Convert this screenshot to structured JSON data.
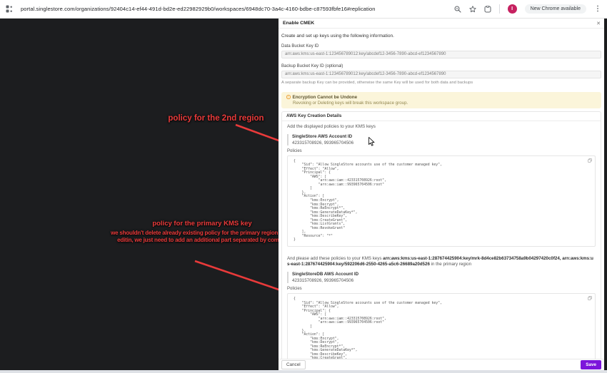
{
  "browser": {
    "url": "portal.singlestore.com/organizations/92404c14-ef44-491d-bd2e-ed22982929b0/workspaces/6948dc70-3a4c-4160-bdbe-c87593fbfe16#replication",
    "update_pill": "New Chrome available",
    "profile_initial": "I",
    "kebab_glyph": "⋮"
  },
  "overlay": {
    "note_second_region": "policy for the 2nd region",
    "note_primary_title": "policy for the primary KMS key",
    "note_primary_body": "we shouldn't delete already existing policy for the primary region when editin, we just need to add an additional part separated by comma"
  },
  "modal": {
    "title": "Enable CMEK",
    "close_glyph": "✕",
    "intro": "Create and set up keys using the following information.",
    "fields": {
      "data_key_label": "Data Bucket Key ID",
      "data_key_value": "arn:aws:kms:us-east-1:123456789012:key/abcdef12-3456-7890-abcd-ef1234567890",
      "backup_key_label": "Backup Bucket Key ID (optional)",
      "backup_key_value": "arn:aws:kms:us-east-1:123456789012:key/abcdef12-3456-7890-abcd-ef1234567890",
      "backup_key_hint": "A separate backup Key can be provided, otherwise the same Key will be used for both data and backups"
    },
    "warning": {
      "icon_glyph": "!",
      "title": "Encryption Cannot be Undone",
      "body": "Revoking or Deleting keys will break this workspace group."
    },
    "aws_section": {
      "title": "AWS Key Creation Details",
      "instruction": "Add the displayed policies to your KMS keys",
      "account_block_1": {
        "label": "SingleStore AWS Account ID",
        "value": "423315708926, 993965704506"
      },
      "policies_label_1": "Policies",
      "policy_code_1": "{\n    \"Sid\": \"Allow SingleStore accounts use of the customer managed key\",\n    \"Effect\": \"Allow\",\n    \"Principal\": {\n        \"AWS\": [\n            \"arn:aws:iam::423315708926:root\",\n            \"arn:aws:iam::993965704506:root\"\n        ]\n    },\n    \"Action\": [\n        \"kms:Encrypt\",\n        \"kms:Decrypt\",\n        \"kms:ReEncrypt*\",\n        \"kms:GenerateDataKey*\",\n        \"kms:DescribeKey\",\n        \"kms:CreateGrant\",\n        \"kms:ListGrants\",\n        \"kms:RevokeGrant\"\n    ],\n    \"Resource\": \"*\"\n}",
      "second_instruction": {
        "prefix": "And please add these policies to your KMS keys ",
        "arns": "arn:aws:kms:us-east-1:287674425904:key/mrk-8d4ce82b63734758a9b04297420c0f24, arn:aws:kms:us-east-1:287674425904:key/592206d6-2550-4265-a5c6-26689a20d526",
        "suffix": " in the primary region"
      },
      "account_block_2": {
        "label": "SingleStoreDB AWS Account ID",
        "value": "423315708926, 993965704506"
      },
      "policies_label_2": "Policies",
      "policy_code_2": "{\n    \"Sid\": \"Allow SingleStore accounts use of the customer managed key\",\n    \"Effect\": \"Allow\",\n    \"Principal\": {\n        \"AWS\": [\n            \"arn:aws:iam::423315708926:root\",\n            \"arn:aws:iam::993965704506:root\"\n        ]\n    },\n    \"Action\": [\n        \"kms:Encrypt\",\n        \"kms:Decrypt\",\n        \"kms:ReEncrypt*\",\n        \"kms:GenerateDataKey*\",\n        \"kms:DescribeKey\",\n        \"kms:CreateGrant\",\n        \"kms:ListGrants\","
    },
    "footer": {
      "cancel_label": "Cancel",
      "save_label": "Save"
    }
  },
  "colors": {
    "accent_purple": "#7c15db",
    "annotation_red": "#e93a3a",
    "warning_bg": "#fbf5da",
    "overlay_dark": "#1c1d1f",
    "avatar_crimson": "#c62160"
  }
}
